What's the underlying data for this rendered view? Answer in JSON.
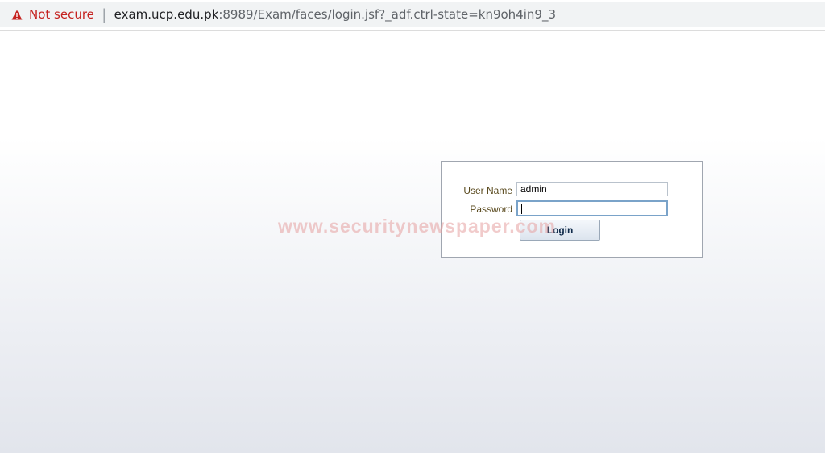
{
  "browser": {
    "security_label": "Not secure",
    "separator": "|",
    "url_host": "exam.ucp.edu.pk",
    "url_path": ":8989/Exam/faces/login.jsf?_adf.ctrl-state=kn9oh4in9_3",
    "warning_icon": "warning-triangle-icon"
  },
  "login": {
    "username_label": "User Name",
    "username_value": "admin",
    "password_label": "Password",
    "password_value": "",
    "login_button": "Login"
  },
  "watermark": "www.securitynewspaper.com",
  "colors": {
    "warning": "#c5221f",
    "label": "#5a4a1e",
    "button_text": "#0f2a4a"
  }
}
